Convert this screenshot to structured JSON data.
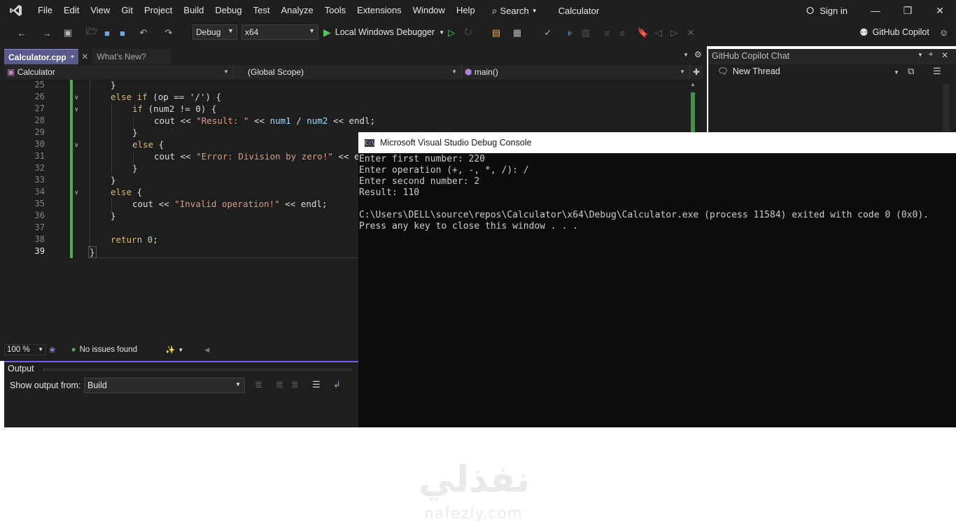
{
  "titlebar": {
    "menu": [
      "File",
      "Edit",
      "View",
      "Git",
      "Project",
      "Build",
      "Debug",
      "Test",
      "Analyze",
      "Tools",
      "Extensions",
      "Window",
      "Help"
    ],
    "search_label": "Search",
    "solution_name": "Calculator",
    "signin_label": "Sign in"
  },
  "toolbar": {
    "configuration": "Debug",
    "platform": "x64",
    "run_label": "Local Windows Debugger",
    "copilot_label": "GitHub Copilot"
  },
  "editor": {
    "tabs": [
      {
        "label": "Calculator.cpp",
        "active": true
      },
      {
        "label": "What's New?",
        "active": false
      }
    ],
    "nav": {
      "project": "Calculator",
      "scope": "(Global Scope)",
      "member": "main()"
    },
    "line_numbers": [
      "25",
      "26",
      "27",
      "28",
      "29",
      "30",
      "31",
      "32",
      "33",
      "34",
      "35",
      "36",
      "37",
      "38",
      "39"
    ],
    "current_line": "39",
    "code": {
      "l25_brace": "}",
      "l26_else": "else",
      "l26_if": "if",
      "l26_rest": " (op == '/') {",
      "l27_if": "if",
      "l27_rest": " (num2 != 0) {",
      "l28_cout": "cout",
      "l28_ops1": " << ",
      "l28_str": "\"Result: \"",
      "l28_ops2": " << ",
      "l28_num1": "num1",
      "l28_ops3": " / ",
      "l28_num2": "num2",
      "l28_ops4": " << ",
      "l28_endl": "endl;",
      "l29_brace": "}",
      "l30_else": "else",
      "l30_rest": " {",
      "l31_cout": "cout",
      "l31_ops": " << ",
      "l31_str": "\"Error: Division by zero!\"",
      "l31_tail": " << e",
      "l32_brace": "}",
      "l33_brace": "}",
      "l34_else": "else",
      "l34_rest": " {",
      "l35_cout": "cout",
      "l35_ops": " << ",
      "l35_str": "\"Invalid operation!\"",
      "l35_tail": " << endl;",
      "l36_brace": "}",
      "l38_return": "return",
      "l38_num": " 0",
      "l38_semi": ";",
      "l39_brace": "}"
    },
    "zoom": "100 %",
    "issues": "No issues found"
  },
  "output": {
    "title": "Output",
    "show_from_label": "Show output from:",
    "source": "Build"
  },
  "copilot_chat": {
    "title": "GitHub Copilot Chat",
    "thread": "New Thread"
  },
  "console": {
    "title": "Microsoft Visual Studio Debug Console",
    "lines": [
      "Enter first number: 220",
      "Enter operation (+, -, *, /): /",
      "Enter second number: 2",
      "Result: 110",
      "",
      "C:\\Users\\DELL\\source\\repos\\Calculator\\x64\\Debug\\Calculator.exe (process 11584) exited with code 0 (0x0).",
      "Press any key to close this window . . ."
    ]
  },
  "watermark": {
    "arabic": "نفذلي",
    "latin": "nafezly.com"
  },
  "colors": {
    "accent": "#7160e8",
    "change_bar": "#4aae56",
    "run_green": "#57c35a"
  }
}
